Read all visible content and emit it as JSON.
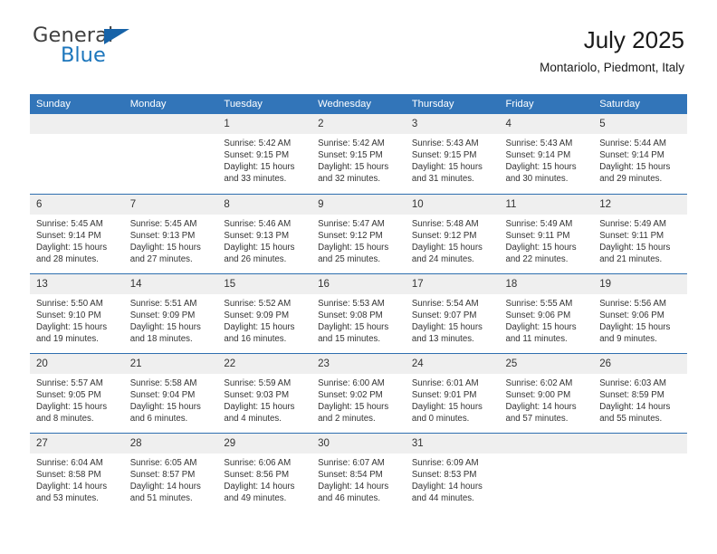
{
  "brand": {
    "name_top": "General",
    "name_bottom": "Blue",
    "accent_color": "#1c76bc",
    "triangle_color": "#1763a8"
  },
  "header": {
    "title": "July 2025",
    "subtitle": "Montariolo, Piedmont, Italy"
  },
  "theme": {
    "header_bg": "#3275b9",
    "header_text": "#ffffff",
    "daynum_bg": "#efefef",
    "row_divider": "#2f6fb0",
    "body_text": "#333333"
  },
  "calendar": {
    "weekday_headers": [
      "Sunday",
      "Monday",
      "Tuesday",
      "Wednesday",
      "Thursday",
      "Friday",
      "Saturday"
    ],
    "labels": {
      "sunrise": "Sunrise:",
      "sunset": "Sunset:",
      "daylight": "Daylight:"
    },
    "weeks": [
      [
        {
          "day": "",
          "sunrise": "",
          "sunset": "",
          "daylight1": "",
          "daylight2": "",
          "empty": true
        },
        {
          "day": "",
          "sunrise": "",
          "sunset": "",
          "daylight1": "",
          "daylight2": "",
          "empty": true
        },
        {
          "day": "1",
          "sunrise": "Sunrise: 5:42 AM",
          "sunset": "Sunset: 9:15 PM",
          "daylight1": "Daylight: 15 hours",
          "daylight2": "and 33 minutes."
        },
        {
          "day": "2",
          "sunrise": "Sunrise: 5:42 AM",
          "sunset": "Sunset: 9:15 PM",
          "daylight1": "Daylight: 15 hours",
          "daylight2": "and 32 minutes."
        },
        {
          "day": "3",
          "sunrise": "Sunrise: 5:43 AM",
          "sunset": "Sunset: 9:15 PM",
          "daylight1": "Daylight: 15 hours",
          "daylight2": "and 31 minutes."
        },
        {
          "day": "4",
          "sunrise": "Sunrise: 5:43 AM",
          "sunset": "Sunset: 9:14 PM",
          "daylight1": "Daylight: 15 hours",
          "daylight2": "and 30 minutes."
        },
        {
          "day": "5",
          "sunrise": "Sunrise: 5:44 AM",
          "sunset": "Sunset: 9:14 PM",
          "daylight1": "Daylight: 15 hours",
          "daylight2": "and 29 minutes."
        }
      ],
      [
        {
          "day": "6",
          "sunrise": "Sunrise: 5:45 AM",
          "sunset": "Sunset: 9:14 PM",
          "daylight1": "Daylight: 15 hours",
          "daylight2": "and 28 minutes."
        },
        {
          "day": "7",
          "sunrise": "Sunrise: 5:45 AM",
          "sunset": "Sunset: 9:13 PM",
          "daylight1": "Daylight: 15 hours",
          "daylight2": "and 27 minutes."
        },
        {
          "day": "8",
          "sunrise": "Sunrise: 5:46 AM",
          "sunset": "Sunset: 9:13 PM",
          "daylight1": "Daylight: 15 hours",
          "daylight2": "and 26 minutes."
        },
        {
          "day": "9",
          "sunrise": "Sunrise: 5:47 AM",
          "sunset": "Sunset: 9:12 PM",
          "daylight1": "Daylight: 15 hours",
          "daylight2": "and 25 minutes."
        },
        {
          "day": "10",
          "sunrise": "Sunrise: 5:48 AM",
          "sunset": "Sunset: 9:12 PM",
          "daylight1": "Daylight: 15 hours",
          "daylight2": "and 24 minutes."
        },
        {
          "day": "11",
          "sunrise": "Sunrise: 5:49 AM",
          "sunset": "Sunset: 9:11 PM",
          "daylight1": "Daylight: 15 hours",
          "daylight2": "and 22 minutes."
        },
        {
          "day": "12",
          "sunrise": "Sunrise: 5:49 AM",
          "sunset": "Sunset: 9:11 PM",
          "daylight1": "Daylight: 15 hours",
          "daylight2": "and 21 minutes."
        }
      ],
      [
        {
          "day": "13",
          "sunrise": "Sunrise: 5:50 AM",
          "sunset": "Sunset: 9:10 PM",
          "daylight1": "Daylight: 15 hours",
          "daylight2": "and 19 minutes."
        },
        {
          "day": "14",
          "sunrise": "Sunrise: 5:51 AM",
          "sunset": "Sunset: 9:09 PM",
          "daylight1": "Daylight: 15 hours",
          "daylight2": "and 18 minutes."
        },
        {
          "day": "15",
          "sunrise": "Sunrise: 5:52 AM",
          "sunset": "Sunset: 9:09 PM",
          "daylight1": "Daylight: 15 hours",
          "daylight2": "and 16 minutes."
        },
        {
          "day": "16",
          "sunrise": "Sunrise: 5:53 AM",
          "sunset": "Sunset: 9:08 PM",
          "daylight1": "Daylight: 15 hours",
          "daylight2": "and 15 minutes."
        },
        {
          "day": "17",
          "sunrise": "Sunrise: 5:54 AM",
          "sunset": "Sunset: 9:07 PM",
          "daylight1": "Daylight: 15 hours",
          "daylight2": "and 13 minutes."
        },
        {
          "day": "18",
          "sunrise": "Sunrise: 5:55 AM",
          "sunset": "Sunset: 9:06 PM",
          "daylight1": "Daylight: 15 hours",
          "daylight2": "and 11 minutes."
        },
        {
          "day": "19",
          "sunrise": "Sunrise: 5:56 AM",
          "sunset": "Sunset: 9:06 PM",
          "daylight1": "Daylight: 15 hours",
          "daylight2": "and 9 minutes."
        }
      ],
      [
        {
          "day": "20",
          "sunrise": "Sunrise: 5:57 AM",
          "sunset": "Sunset: 9:05 PM",
          "daylight1": "Daylight: 15 hours",
          "daylight2": "and 8 minutes."
        },
        {
          "day": "21",
          "sunrise": "Sunrise: 5:58 AM",
          "sunset": "Sunset: 9:04 PM",
          "daylight1": "Daylight: 15 hours",
          "daylight2": "and 6 minutes."
        },
        {
          "day": "22",
          "sunrise": "Sunrise: 5:59 AM",
          "sunset": "Sunset: 9:03 PM",
          "daylight1": "Daylight: 15 hours",
          "daylight2": "and 4 minutes."
        },
        {
          "day": "23",
          "sunrise": "Sunrise: 6:00 AM",
          "sunset": "Sunset: 9:02 PM",
          "daylight1": "Daylight: 15 hours",
          "daylight2": "and 2 minutes."
        },
        {
          "day": "24",
          "sunrise": "Sunrise: 6:01 AM",
          "sunset": "Sunset: 9:01 PM",
          "daylight1": "Daylight: 15 hours",
          "daylight2": "and 0 minutes."
        },
        {
          "day": "25",
          "sunrise": "Sunrise: 6:02 AM",
          "sunset": "Sunset: 9:00 PM",
          "daylight1": "Daylight: 14 hours",
          "daylight2": "and 57 minutes."
        },
        {
          "day": "26",
          "sunrise": "Sunrise: 6:03 AM",
          "sunset": "Sunset: 8:59 PM",
          "daylight1": "Daylight: 14 hours",
          "daylight2": "and 55 minutes."
        }
      ],
      [
        {
          "day": "27",
          "sunrise": "Sunrise: 6:04 AM",
          "sunset": "Sunset: 8:58 PM",
          "daylight1": "Daylight: 14 hours",
          "daylight2": "and 53 minutes."
        },
        {
          "day": "28",
          "sunrise": "Sunrise: 6:05 AM",
          "sunset": "Sunset: 8:57 PM",
          "daylight1": "Daylight: 14 hours",
          "daylight2": "and 51 minutes."
        },
        {
          "day": "29",
          "sunrise": "Sunrise: 6:06 AM",
          "sunset": "Sunset: 8:56 PM",
          "daylight1": "Daylight: 14 hours",
          "daylight2": "and 49 minutes."
        },
        {
          "day": "30",
          "sunrise": "Sunrise: 6:07 AM",
          "sunset": "Sunset: 8:54 PM",
          "daylight1": "Daylight: 14 hours",
          "daylight2": "and 46 minutes."
        },
        {
          "day": "31",
          "sunrise": "Sunrise: 6:09 AM",
          "sunset": "Sunset: 8:53 PM",
          "daylight1": "Daylight: 14 hours",
          "daylight2": "and 44 minutes."
        },
        {
          "day": "",
          "sunrise": "",
          "sunset": "",
          "daylight1": "",
          "daylight2": "",
          "empty": true
        },
        {
          "day": "",
          "sunrise": "",
          "sunset": "",
          "daylight1": "",
          "daylight2": "",
          "empty": true
        }
      ]
    ]
  }
}
